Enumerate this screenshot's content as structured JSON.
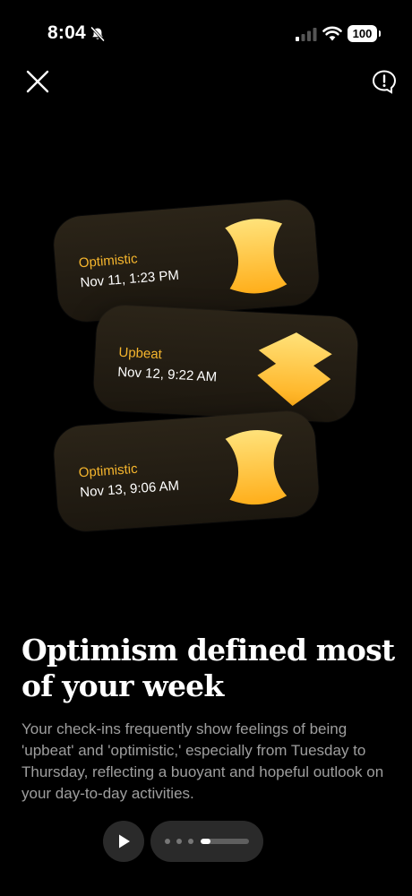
{
  "status_bar": {
    "time": "8:04",
    "battery": "100"
  },
  "cards": [
    {
      "mood": "Optimistic",
      "date": "Nov 11, 1:23 PM",
      "shape_icon": "optimistic-mood-icon"
    },
    {
      "mood": "Upbeat",
      "date": "Nov 12, 9:22 AM",
      "shape_icon": "upbeat-mood-icon"
    },
    {
      "mood": "Optimistic",
      "date": "Nov 13, 9:06 AM",
      "shape_icon": "optimistic-mood-icon"
    }
  ],
  "headline": "Optimism defined most of your week",
  "description": "Your check-ins frequently show feelings of being 'upbeat' and 'optimistic,' especially from Tuesday to Thursday, reflecting a buoyant and hopeful outlook on your day-to-day activities.",
  "playback": {
    "progress": 0.2
  },
  "colors": {
    "accent": "#f5b52d",
    "gradient_top": "#ffe27a",
    "gradient_bottom": "#ffae1a",
    "background": "#000000",
    "card": "#231d13"
  }
}
